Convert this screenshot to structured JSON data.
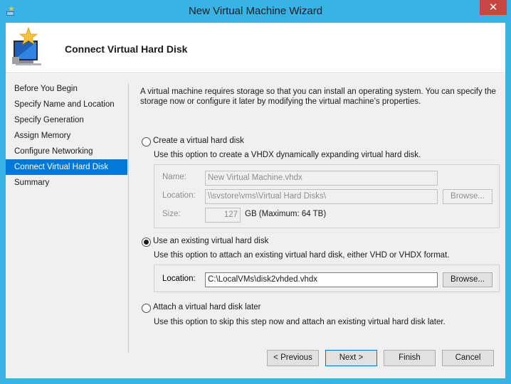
{
  "window": {
    "title": "New Virtual Machine Wizard",
    "close_glyph": "✕"
  },
  "header": {
    "title": "Connect Virtual Hard Disk"
  },
  "nav": {
    "items": [
      {
        "label": "Before You Begin"
      },
      {
        "label": "Specify Name and Location"
      },
      {
        "label": "Specify Generation"
      },
      {
        "label": "Assign Memory"
      },
      {
        "label": "Configure Networking"
      },
      {
        "label": "Connect Virtual Hard Disk"
      },
      {
        "label": "Summary"
      }
    ],
    "active_index": 5
  },
  "content": {
    "intro": "A virtual machine requires storage so that you can install an operating system. You can specify the storage now or configure it later by modifying the virtual machine’s properties.",
    "create_option": {
      "label": "Create a virtual hard disk",
      "description": "Use this option to create a VHDX dynamically expanding virtual hard disk.",
      "name_label": "Name:",
      "name_value": "New Virtual Machine.vhdx",
      "location_label": "Location:",
      "location_value": "\\\\svstore\\vms\\Virtual Hard Disks\\",
      "browse_label": "Browse...",
      "size_label": "Size:",
      "size_value": "127",
      "size_suffix": "GB (Maximum: 64 TB)"
    },
    "existing_option": {
      "label": "Use an existing virtual hard disk",
      "description": "Use this option to attach an existing virtual hard disk, either VHD or VHDX format.",
      "location_label": "Location:",
      "location_value": "C:\\LocalVMs\\disk2vhded.vhdx",
      "browse_label": "Browse..."
    },
    "later_option": {
      "label": "Attach a virtual hard disk later",
      "description": "Use this option to skip this step now and attach an existing virtual hard disk later."
    },
    "selected_option": "existing"
  },
  "footer": {
    "previous_label": "< Previous",
    "next_label": "Next >",
    "finish_label": "Finish",
    "cancel_label": "Cancel"
  },
  "colors": {
    "title_bar": "#39b2e6",
    "nav_active": "#0078d7",
    "close_button": "#c7463f"
  }
}
